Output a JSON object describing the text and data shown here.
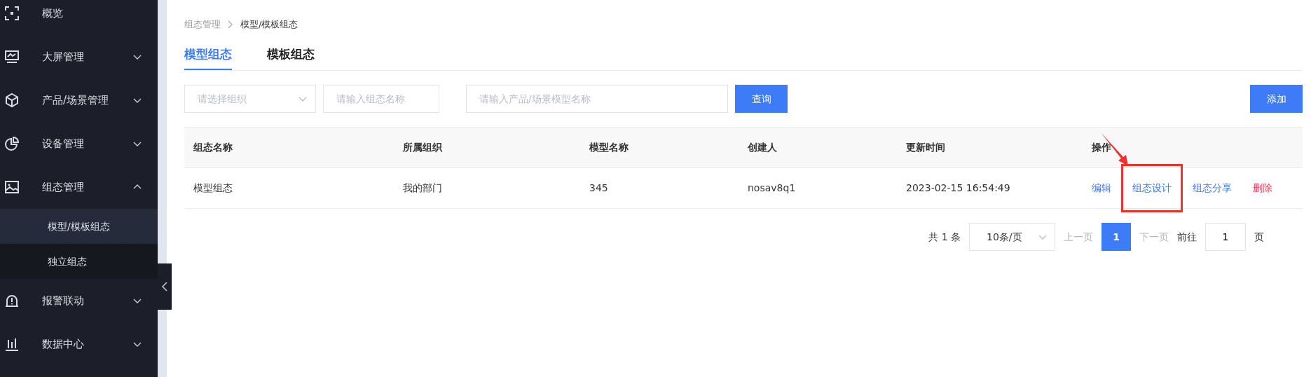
{
  "sidebar": {
    "items": [
      {
        "label": "概览"
      },
      {
        "label": "大屏管理",
        "expandable": true,
        "expanded": false
      },
      {
        "label": "产品/场景管理",
        "expandable": true,
        "expanded": false
      },
      {
        "label": "设备管理",
        "expandable": true,
        "expanded": false
      },
      {
        "label": "组态管理",
        "expandable": true,
        "expanded": true,
        "children": [
          {
            "label": "模型/模板组态",
            "selected": true
          },
          {
            "label": "独立组态",
            "selected": false
          }
        ]
      },
      {
        "label": "报警联动",
        "expandable": true,
        "expanded": false
      },
      {
        "label": "数据中心",
        "expandable": true,
        "expanded": false
      }
    ]
  },
  "breadcrumb": [
    "组态管理",
    "模型/模板组态"
  ],
  "tabs": [
    {
      "label": "模型组态",
      "selected": true
    },
    {
      "label": "模板组态",
      "selected": false
    }
  ],
  "filters": {
    "organization": {
      "placeholder": "请选择组织"
    },
    "name": {
      "placeholder": "请输入组态名称"
    },
    "model": {
      "placeholder": "请输入产品/场景模型名称"
    },
    "query_button": "查询",
    "add_button": "添加"
  },
  "table": {
    "columns": [
      "组态名称",
      "所属组织",
      "模型名称",
      "创建人",
      "更新时间",
      "操作"
    ],
    "rows": [
      {
        "cells": [
          "模型组态",
          "我的部门",
          "345",
          "nosav8q1",
          "2023-02-15 16:54:49"
        ],
        "actions": [
          {
            "label": "编辑",
            "kind": "normal",
            "highlighted": false
          },
          {
            "label": "组态设计",
            "kind": "normal",
            "highlighted": true
          },
          {
            "label": "组态分享",
            "kind": "normal",
            "highlighted": false
          },
          {
            "label": "删除",
            "kind": "danger",
            "highlighted": false
          }
        ]
      }
    ]
  },
  "pagination": {
    "total": "共 1 条",
    "page_size": "10条/页",
    "prev": "上一页",
    "pages": [
      {
        "label": "1",
        "selected": true
      }
    ],
    "next": "下一页",
    "goto": "前往",
    "goto_value": "1",
    "page_unit": "页"
  }
}
